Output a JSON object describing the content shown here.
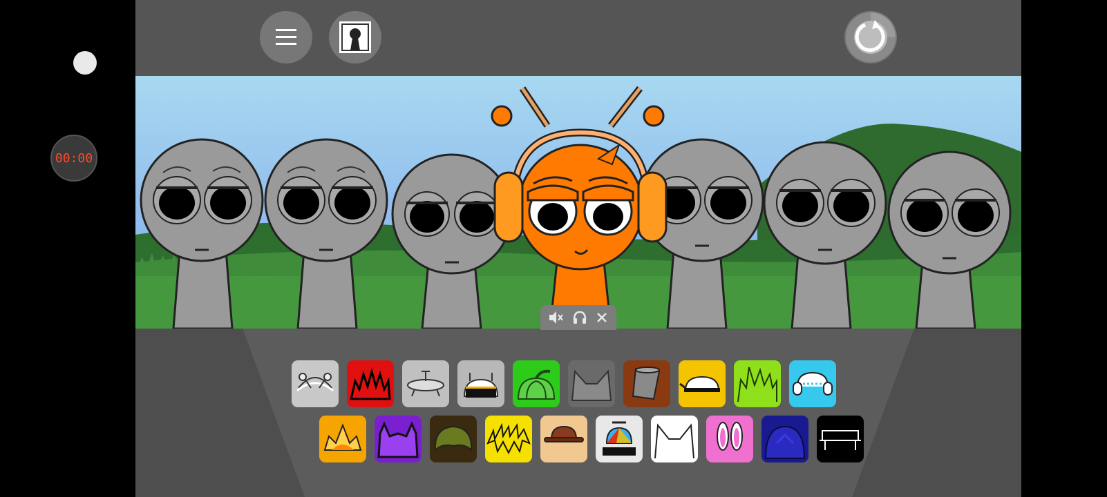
{
  "recorder": {
    "timer": "00:00",
    "timer_color": "#ff4b2b"
  },
  "toolbar": {
    "menu_icon": "hamburger-icon",
    "portrait_icon": "keyhole-portrait-icon",
    "reset_icon": "reset-icon"
  },
  "scene": {
    "characters": [
      {
        "slot": 1,
        "state": "empty",
        "color": "#9a9a9a"
      },
      {
        "slot": 2,
        "state": "empty",
        "color": "#9a9a9a"
      },
      {
        "slot": 3,
        "state": "empty",
        "color": "#9a9a9a"
      },
      {
        "slot": 4,
        "state": "active",
        "color": "#ff7a00",
        "accessories": [
          "antennae",
          "headphones"
        ]
      },
      {
        "slot": 5,
        "state": "empty",
        "color": "#9a9a9a"
      },
      {
        "slot": 6,
        "state": "empty",
        "color": "#9a9a9a"
      },
      {
        "slot": 7,
        "state": "empty",
        "color": "#9a9a9a"
      }
    ],
    "sound_controls": [
      "mute-icon",
      "headphones-icon",
      "close-icon"
    ]
  },
  "palette": {
    "row1": [
      {
        "name": "gray-antennae",
        "color": "#c8c8c8"
      },
      {
        "name": "red-spiky-hair",
        "color": "#e01010"
      },
      {
        "name": "gray-disc-hat",
        "color": "#c0c0c0"
      },
      {
        "name": "dark-antenna-visor",
        "color": "#b8b8b8"
      },
      {
        "name": "green-pumpkin",
        "color": "#2ecc1a"
      },
      {
        "name": "gray-cat-ears",
        "color": "#6a6a6a"
      },
      {
        "name": "brown-bucket",
        "color": "#8a3a10"
      },
      {
        "name": "yellow-cap",
        "color": "#f5c400"
      },
      {
        "name": "lime-spiky-hair",
        "color": "#8fe01a"
      },
      {
        "name": "cyan-headphones",
        "color": "#37c8ee"
      }
    ],
    "row2": [
      {
        "name": "orange-crown",
        "color": "#f5a400"
      },
      {
        "name": "purple-horns",
        "color": "#7a1fd0"
      },
      {
        "name": "olive-hair",
        "color": "#3a2a10"
      },
      {
        "name": "yellow-lightning-hair",
        "color": "#f5e000"
      },
      {
        "name": "tan-hat",
        "color": "#f0c890"
      },
      {
        "name": "propeller-cap",
        "color": "#e8e8e8"
      },
      {
        "name": "white-cat-ears",
        "color": "#ffffff"
      },
      {
        "name": "pink-bunny-ears",
        "color": "#f070d0"
      },
      {
        "name": "navy-helmet",
        "color": "#1a1a90"
      },
      {
        "name": "black-bench",
        "color": "#000000"
      }
    ]
  }
}
